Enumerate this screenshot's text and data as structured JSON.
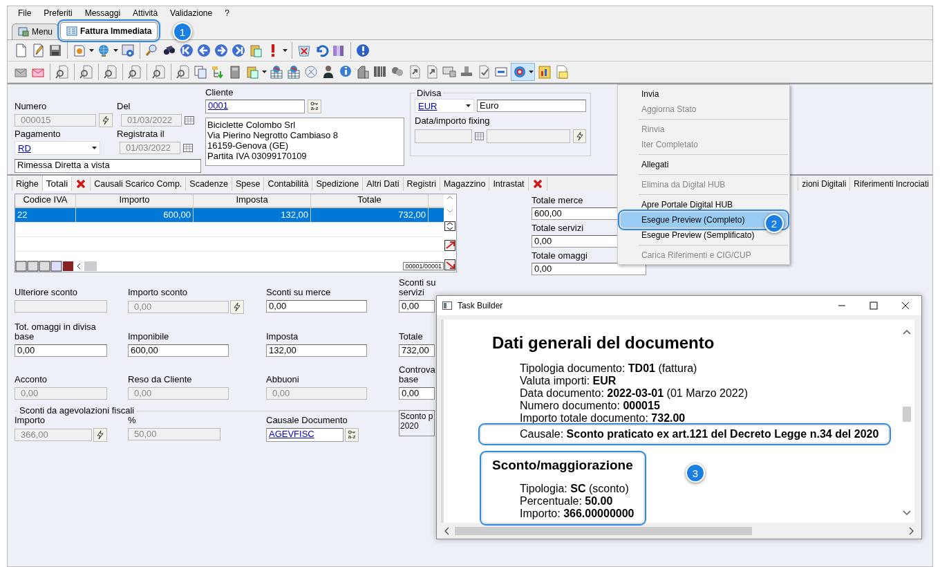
{
  "menu_bar": [
    "File",
    "Preferiti",
    "Messaggi",
    "Attività",
    "Validazione",
    "?"
  ],
  "doc_tabs": [
    {
      "label": "Menu",
      "selected": false,
      "highlighted": false
    },
    {
      "label": "Fattura Immediata",
      "selected": true,
      "highlighted": true,
      "callout": "1"
    }
  ],
  "header": {
    "numero": {
      "label": "Numero",
      "value": "000015",
      "disabled": true
    },
    "del": {
      "label": "Del",
      "value": "01/03/2022",
      "disabled": true
    },
    "pagamento": {
      "label": "Pagamento",
      "value": "RD"
    },
    "registrata": {
      "label": "Registrata il",
      "value": "01/03/2022",
      "disabled": true
    },
    "pagamento_desc": "Rimessa Diretta a vista",
    "cliente": {
      "label": "Cliente",
      "value": "0001",
      "lookup": "a-z",
      "address": [
        "Biciclette Colombo Srl",
        "Via Pierino Negrotto Cambiaso 8",
        "16159-Genova (GE)",
        "Partita IVA 03099170109"
      ]
    },
    "divisa": {
      "legend": "Divisa",
      "code": "EUR",
      "name": "Euro",
      "fixing_label": "Data/importo fixing"
    }
  },
  "section_tabs": [
    {
      "kind": "text",
      "label": "Righe",
      "selected": false
    },
    {
      "kind": "text",
      "label": "Totali",
      "selected": true
    },
    {
      "kind": "error",
      "selected": false
    },
    {
      "kind": "text",
      "label": "Causali Scarico Comp.",
      "selected": false
    },
    {
      "kind": "text",
      "label": "Scadenze",
      "selected": false
    },
    {
      "kind": "text",
      "label": "Spese",
      "selected": false
    },
    {
      "kind": "text",
      "label": "Contabilità",
      "selected": false
    },
    {
      "kind": "text",
      "label": "Spedizione",
      "selected": false
    },
    {
      "kind": "text",
      "label": "Altri Dati",
      "selected": false
    },
    {
      "kind": "text",
      "label": "Registri",
      "selected": false
    },
    {
      "kind": "text",
      "label": "Magazzino",
      "selected": false
    },
    {
      "kind": "text",
      "label": "Intrastat",
      "selected": false
    },
    {
      "kind": "error",
      "selected": false
    },
    {
      "kind": "hidden",
      "selected": false
    },
    {
      "kind": "text",
      "label": "zioni Digitali",
      "selected": false
    },
    {
      "kind": "text",
      "label": "Riferimenti Incrociati",
      "selected": false
    }
  ],
  "vat_table": {
    "columns": [
      "Codice IVA",
      "Importo",
      "Imposta",
      "Totale"
    ],
    "rows": [
      {
        "cells": [
          "22",
          "600,00",
          "132,00",
          "732,00"
        ],
        "selected": true
      }
    ],
    "counter": "00001/00001"
  },
  "totals": [
    {
      "label": "Totale merce",
      "value": "600,00"
    },
    {
      "label": "Totale servizi",
      "value": "0,00"
    },
    {
      "label": "Totale omaggi",
      "value": "0,00"
    }
  ],
  "fields": [
    [
      {
        "label": "Ulteriore sconto",
        "disabled": true
      },
      {
        "label": "Importo sconto",
        "value": "0,00",
        "disabled": true,
        "button": true
      },
      {
        "label": "Sconti su merce",
        "value": "0,00",
        "disabled": false
      },
      {
        "label": "Sconti su servizi",
        "value": "0,00",
        "disabled": false
      }
    ],
    [
      {
        "label": "Tot. omaggi in divisa base",
        "value": "0,00",
        "disabled": false
      },
      {
        "label": "Imponibile",
        "value": "600,00",
        "disabled": false
      },
      {
        "label": "Imposta",
        "value": "132,00",
        "disabled": false
      },
      {
        "label": "Totale",
        "value": "732,00",
        "disabled": false
      }
    ],
    [
      {
        "label": "Acconto",
        "value": "0,00",
        "disabled": true
      },
      {
        "label": "Reso da Cliente",
        "value": "0,00",
        "disabled": true
      },
      {
        "label": "Abbuoni",
        "value": "0,00",
        "disabled": true
      },
      {
        "label": "Controva base",
        "value": "0,00",
        "disabled": false
      }
    ]
  ],
  "agevolazioni": {
    "legend": "Sconti da agevolazioni fiscali",
    "importo": {
      "label": "Importo",
      "value": "366,00",
      "disabled": true
    },
    "percent": {
      "label": "%",
      "value": "50,00",
      "disabled": true
    },
    "causale": {
      "label": "Causale Documento",
      "value": "AGEVFISC",
      "lookup": "a-z"
    },
    "note": [
      "Sconto p",
      "2020"
    ]
  },
  "dropdown_menu": [
    {
      "kind": "item",
      "label": "Invia",
      "disabled": false,
      "selected": false
    },
    {
      "kind": "item",
      "label": "Aggiorna Stato",
      "disabled": true,
      "selected": false
    },
    {
      "kind": "separator"
    },
    {
      "kind": "item",
      "label": "Rinvia",
      "disabled": true,
      "selected": false
    },
    {
      "kind": "item",
      "label": "Iter Completato",
      "disabled": true,
      "selected": false
    },
    {
      "kind": "separator"
    },
    {
      "kind": "item",
      "label": "Allegati",
      "disabled": false,
      "selected": false
    },
    {
      "kind": "separator"
    },
    {
      "kind": "item",
      "label": "Elimina da Digital HUB",
      "disabled": true,
      "selected": false
    },
    {
      "kind": "separator"
    },
    {
      "kind": "item",
      "label": "Apre Portale Digital HUB",
      "disabled": false,
      "selected": false
    },
    {
      "kind": "item",
      "label": "Esegue Preview (Completo)",
      "disabled": false,
      "selected": true,
      "callout": "2"
    },
    {
      "kind": "item",
      "label": "Esegue Preview (Semplificato)",
      "disabled": false,
      "selected": false
    },
    {
      "kind": "separator"
    },
    {
      "kind": "item",
      "label": "Carica Riferimenti e CIG/CUP",
      "disabled": true,
      "selected": false
    }
  ],
  "preview_window": {
    "title": "Task Builder",
    "sections": [
      {
        "heading": "Dati generali del documento",
        "highlighted": false,
        "lines": [
          {
            "text": "Tipologia documento: **TD01** (fattura)",
            "highlighted": false
          },
          {
            "text": "Valuta importi: **EUR**",
            "highlighted": false
          },
          {
            "text": "Data documento: **2022-03-01** (01 Marzo 2022)",
            "highlighted": false
          },
          {
            "text": "Numero documento: **000015**",
            "highlighted": false
          },
          {
            "text": "Importo totale documento: **732.00**",
            "highlighted": false
          },
          {
            "text": "Causale: **Sconto praticato ex art.121 del Decreto Legge n.34 del 2020**",
            "highlighted": true
          }
        ]
      },
      {
        "heading": "Sconto/maggiorazione",
        "highlighted": true,
        "callout": "3",
        "lines": [
          {
            "text": "Tipologia: **SC** (sconto)",
            "highlighted": false
          },
          {
            "text": "Percentuale: **50.00**",
            "highlighted": false
          },
          {
            "text": "Importo: **366.00000000**",
            "highlighted": false
          }
        ]
      }
    ]
  }
}
